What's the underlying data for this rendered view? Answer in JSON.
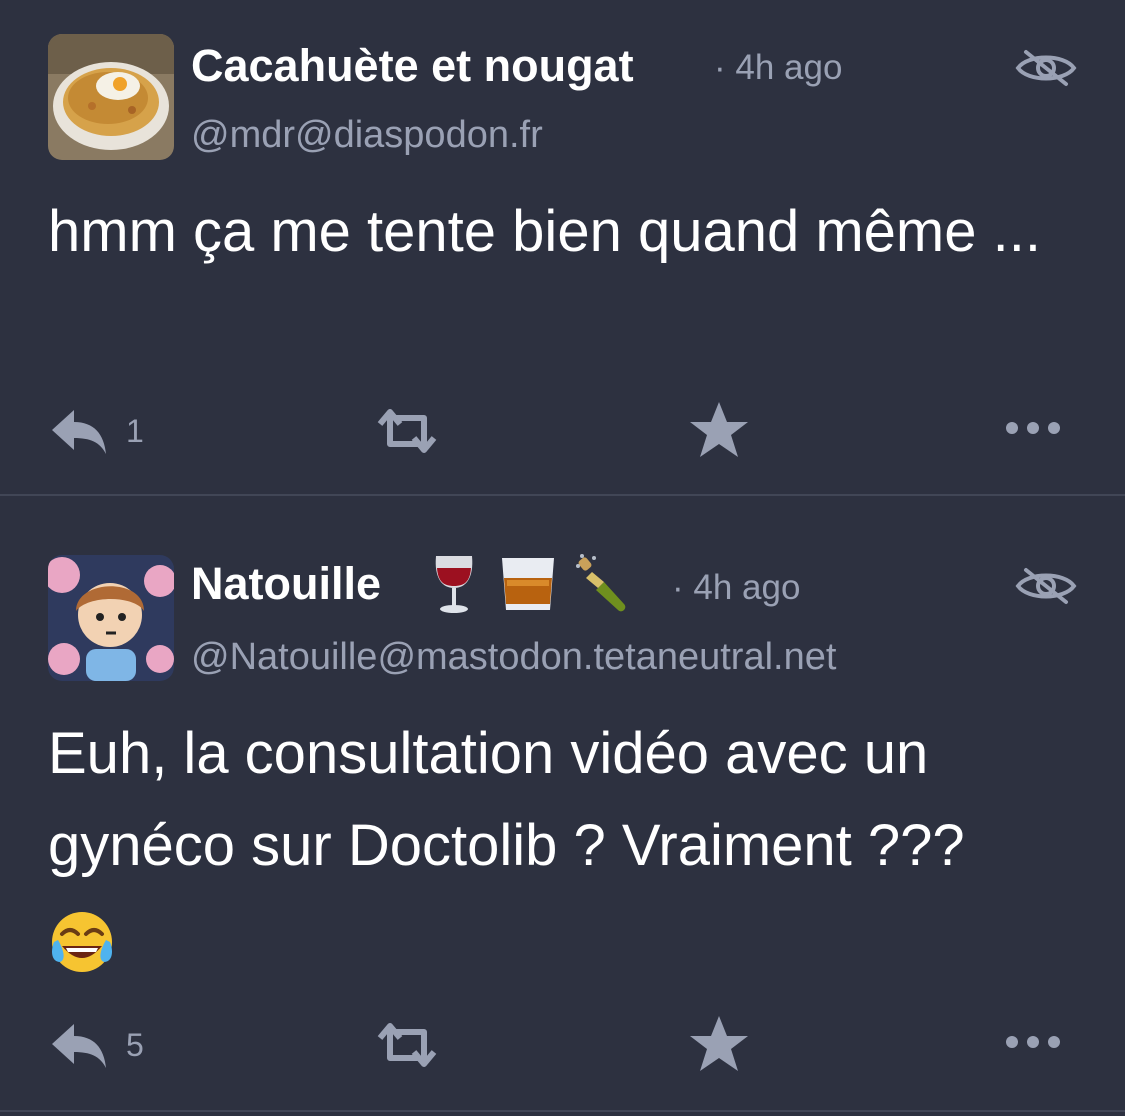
{
  "posts": [
    {
      "display_name": "Cacahuète et nougat",
      "time": "· 4h ago",
      "handle": "@mdr@diaspodon.fr",
      "content": "hmm ça me tente bien quand même ...",
      "reply_count": "1",
      "avatar_icon": "food-dish-photo",
      "emojis": []
    },
    {
      "display_name": "Natouille",
      "time": "· 4h ago",
      "handle": "@Natouille@mastodon.tetaneutral.net",
      "content": "Euh, la consultation vidéo avec un gynéco sur Doctolib ? Vraiment ???",
      "reply_count": "5",
      "avatar_icon": "cartoon-avatar",
      "emojis": [
        "wine-glass-emoji",
        "tumbler-glass-emoji",
        "champagne-bottle-emoji"
      ],
      "trailing_emoji": "face-with-tears-of-joy-emoji"
    }
  ],
  "icons": {
    "hide": "eye-slash-icon",
    "reply": "reply-icon",
    "boost": "boost-icon",
    "favourite": "star-icon",
    "more": "more-icon"
  },
  "colors": {
    "background": "#2d3140",
    "text": "#ffffff",
    "muted": "#9aa1b4",
    "separator": "#414656"
  }
}
